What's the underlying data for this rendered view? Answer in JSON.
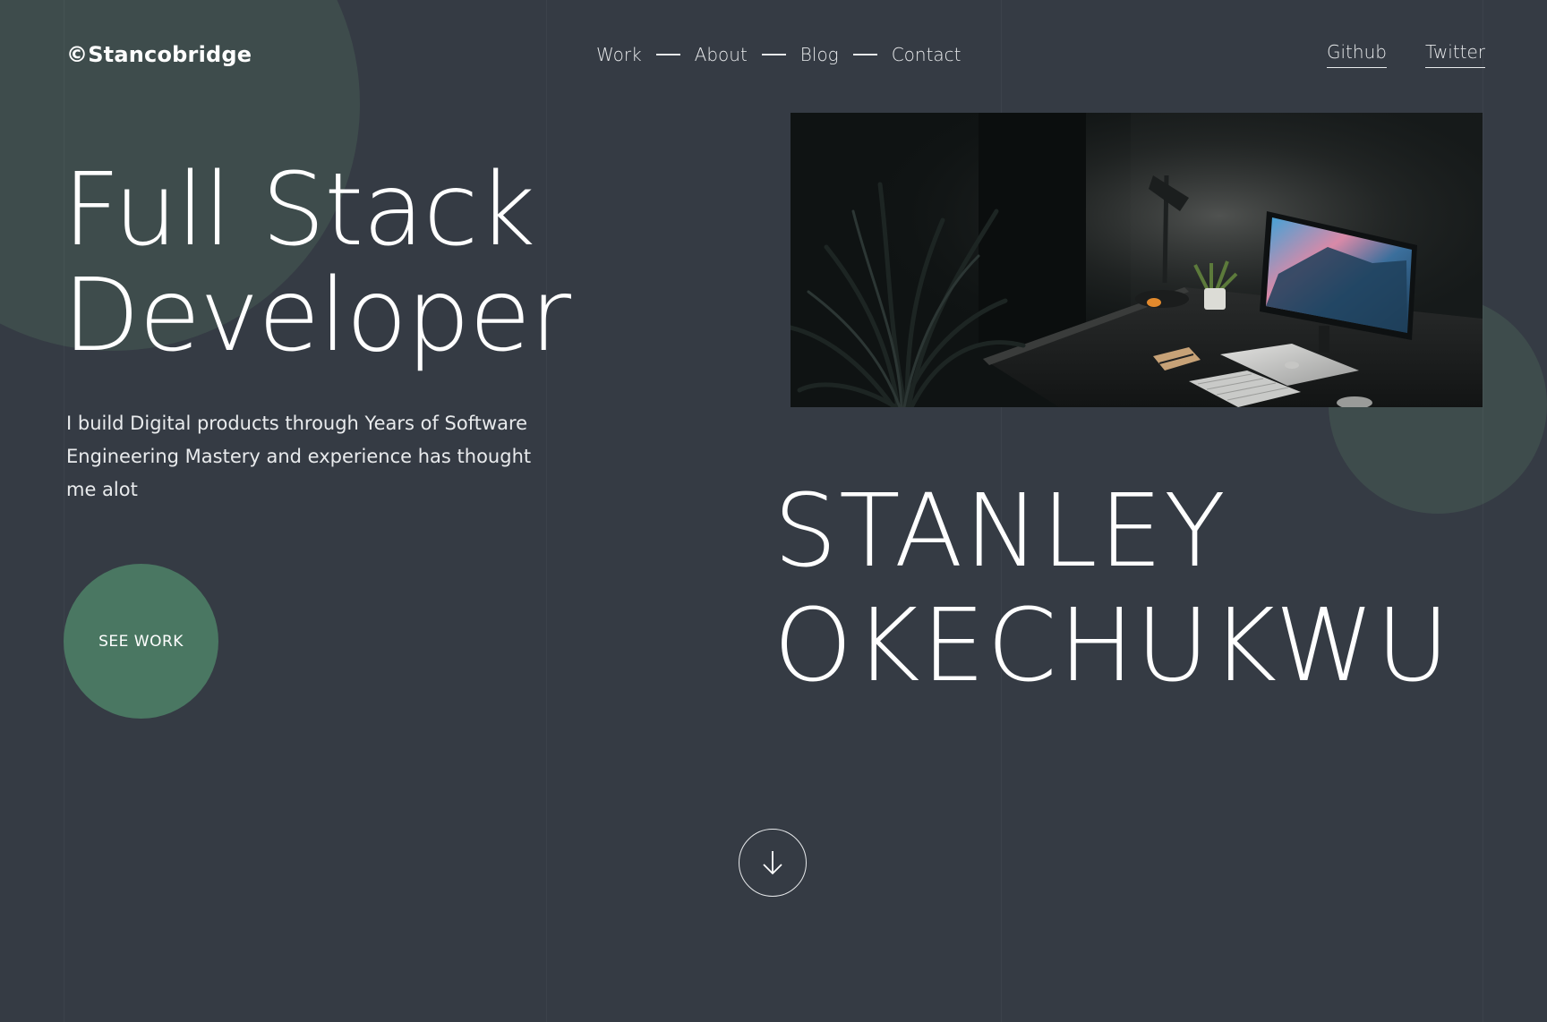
{
  "header": {
    "logo": "©Stancobridge",
    "nav": [
      {
        "label": "Work"
      },
      {
        "label": "About"
      },
      {
        "label": "Blog"
      },
      {
        "label": "Contact"
      }
    ],
    "social": [
      {
        "label": "Github"
      },
      {
        "label": "Twitter"
      }
    ]
  },
  "hero": {
    "title_line1": "Full Stack",
    "title_line2": "Developer",
    "description": "I build Digital products through Years of Software Engineering Mastery and experience has thought me alot",
    "cta_label": "SEE WORK",
    "name_line1": "STANLEY",
    "name_line2": "OKECHUKWU",
    "scroll_icon": "arrow-down-icon",
    "image_subject": "dark desk with monitor, laptop, lamp and plant"
  },
  "colors": {
    "background": "#353b44",
    "deco_circle": "#3e4c4c",
    "cta": "#4a7762",
    "text": "#ffffff"
  }
}
